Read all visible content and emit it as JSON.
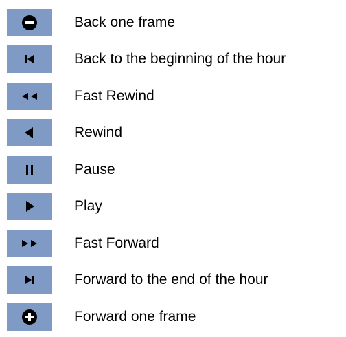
{
  "controls": [
    {
      "icon": "minus-circle-icon",
      "label": "Back one frame"
    },
    {
      "icon": "skip-to-start-icon",
      "label": "Back to the beginning of the hour"
    },
    {
      "icon": "fast-rewind-icon",
      "label": "Fast Rewind"
    },
    {
      "icon": "rewind-icon",
      "label": "Rewind"
    },
    {
      "icon": "pause-icon",
      "label": "Pause"
    },
    {
      "icon": "play-icon",
      "label": "Play"
    },
    {
      "icon": "fast-forward-icon",
      "label": "Fast Forward"
    },
    {
      "icon": "skip-to-end-icon",
      "label": "Forward to the end of the hour"
    },
    {
      "icon": "plus-circle-icon",
      "label": "Forward one frame"
    }
  ],
  "colors": {
    "button_background": "#7f9ac4",
    "icon": "#000000",
    "text": "#000000"
  }
}
